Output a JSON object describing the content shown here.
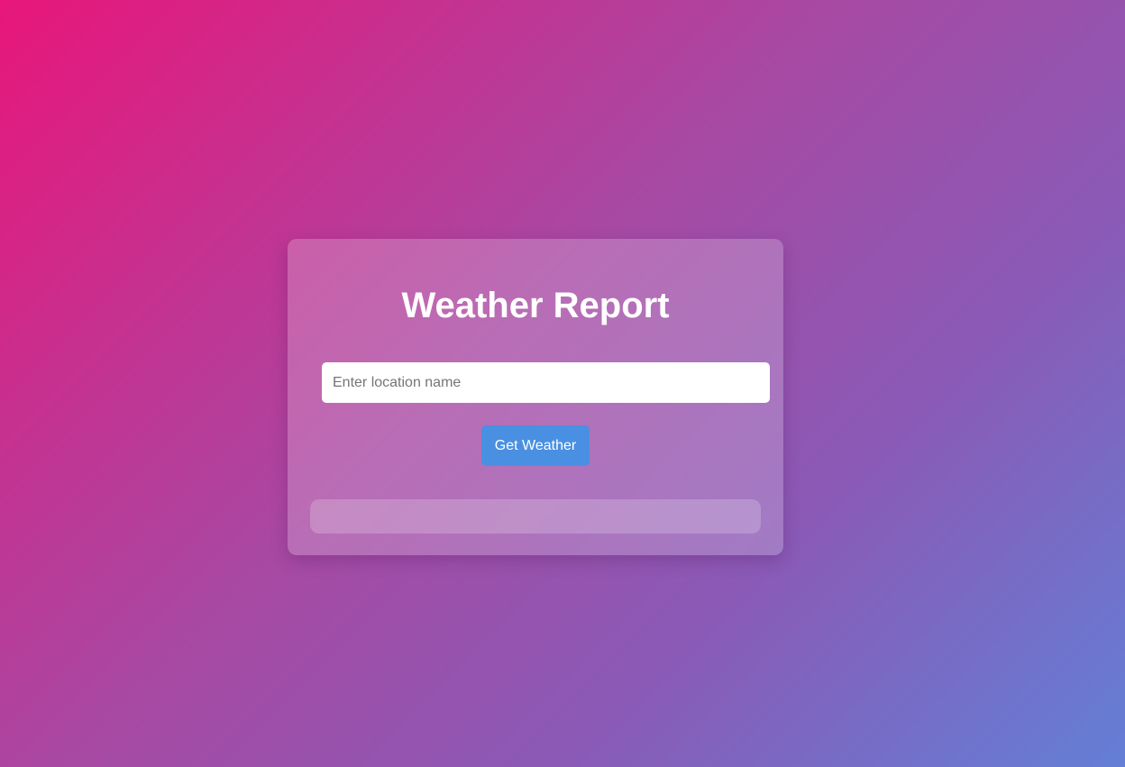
{
  "weather_card": {
    "title": "Weather Report",
    "location_input": {
      "value": "",
      "placeholder": "Enter location name"
    },
    "get_weather_label": "Get Weather",
    "result_text": ""
  },
  "colors": {
    "gradient_start": "#e8167a",
    "gradient_end": "#637fd6",
    "button": "#4a90e2",
    "text": "#ffffff"
  }
}
